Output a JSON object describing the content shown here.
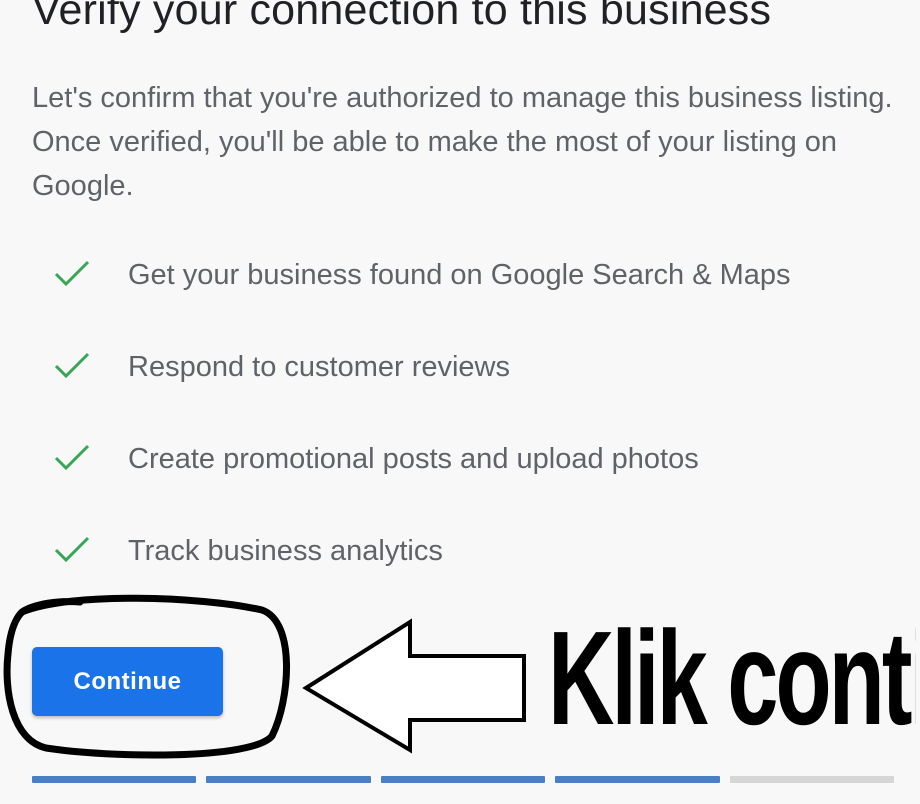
{
  "page": {
    "title": "Verify your connection to this business",
    "description": "Let's confirm that you're authorized to manage this business listing. Once verified, you'll be able to make the most of your listing on Google."
  },
  "features": [
    {
      "icon": "check-icon",
      "text": "Get your business found on Google Search & Maps"
    },
    {
      "icon": "check-icon",
      "text": "Respond to customer reviews"
    },
    {
      "icon": "check-icon",
      "text": "Create promotional posts and upload photos"
    },
    {
      "icon": "check-icon",
      "text": "Track business analytics"
    }
  ],
  "actions": {
    "continue_label": "Continue"
  },
  "annotation": {
    "text": "Klik continue",
    "marks": [
      "hand-drawn-circle",
      "outline-arrow-left"
    ]
  },
  "progress": {
    "total_steps": 5,
    "completed_steps": 4
  },
  "colors": {
    "accent": "#1a73e8",
    "check": "#34a853",
    "progress_done": "#4a7fc8",
    "progress_todo": "#d6d6d6",
    "title": "#202124",
    "body_text": "#5f6368",
    "annotation": "#000000"
  }
}
